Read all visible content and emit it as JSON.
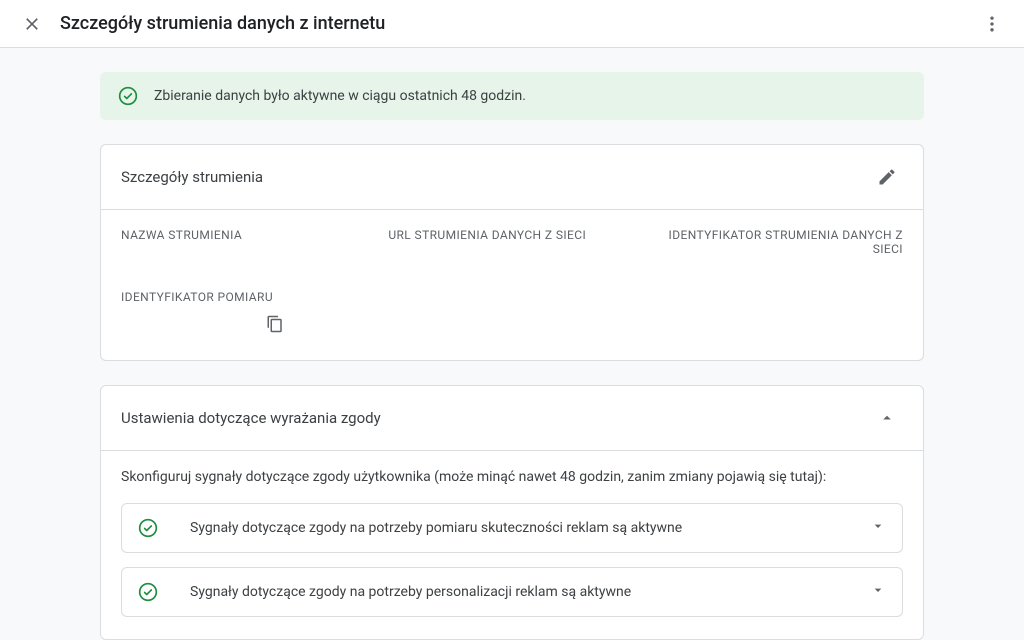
{
  "header": {
    "title": "Szczegóły strumienia danych z internetu"
  },
  "status": {
    "message": "Zbieranie danych było aktywne w ciągu ostatnich 48 godzin."
  },
  "streamDetails": {
    "title": "Szczegóły strumienia",
    "fields": {
      "name_label": "NAZWA STRUMIENIA",
      "url_label": "URL STRUMIENIA DANYCH Z SIECI",
      "id_label": "IDENTYFIKATOR STRUMIENIA DANYCH Z SIECI",
      "measurement_label": "IDENTYFIKATOR POMIARU"
    }
  },
  "consent": {
    "title": "Ustawienia dotyczące wyrażania zgody",
    "description": "Skonfiguruj sygnały dotyczące zgody użytkownika (może minąć nawet 48 godzin, zanim zmiany pojawią się tutaj):",
    "items": [
      "Sygnały dotyczące zgody na potrzeby pomiaru skuteczności reklam są aktywne",
      "Sygnały dotyczące zgody na potrzeby personalizacji reklam są aktywne"
    ]
  }
}
